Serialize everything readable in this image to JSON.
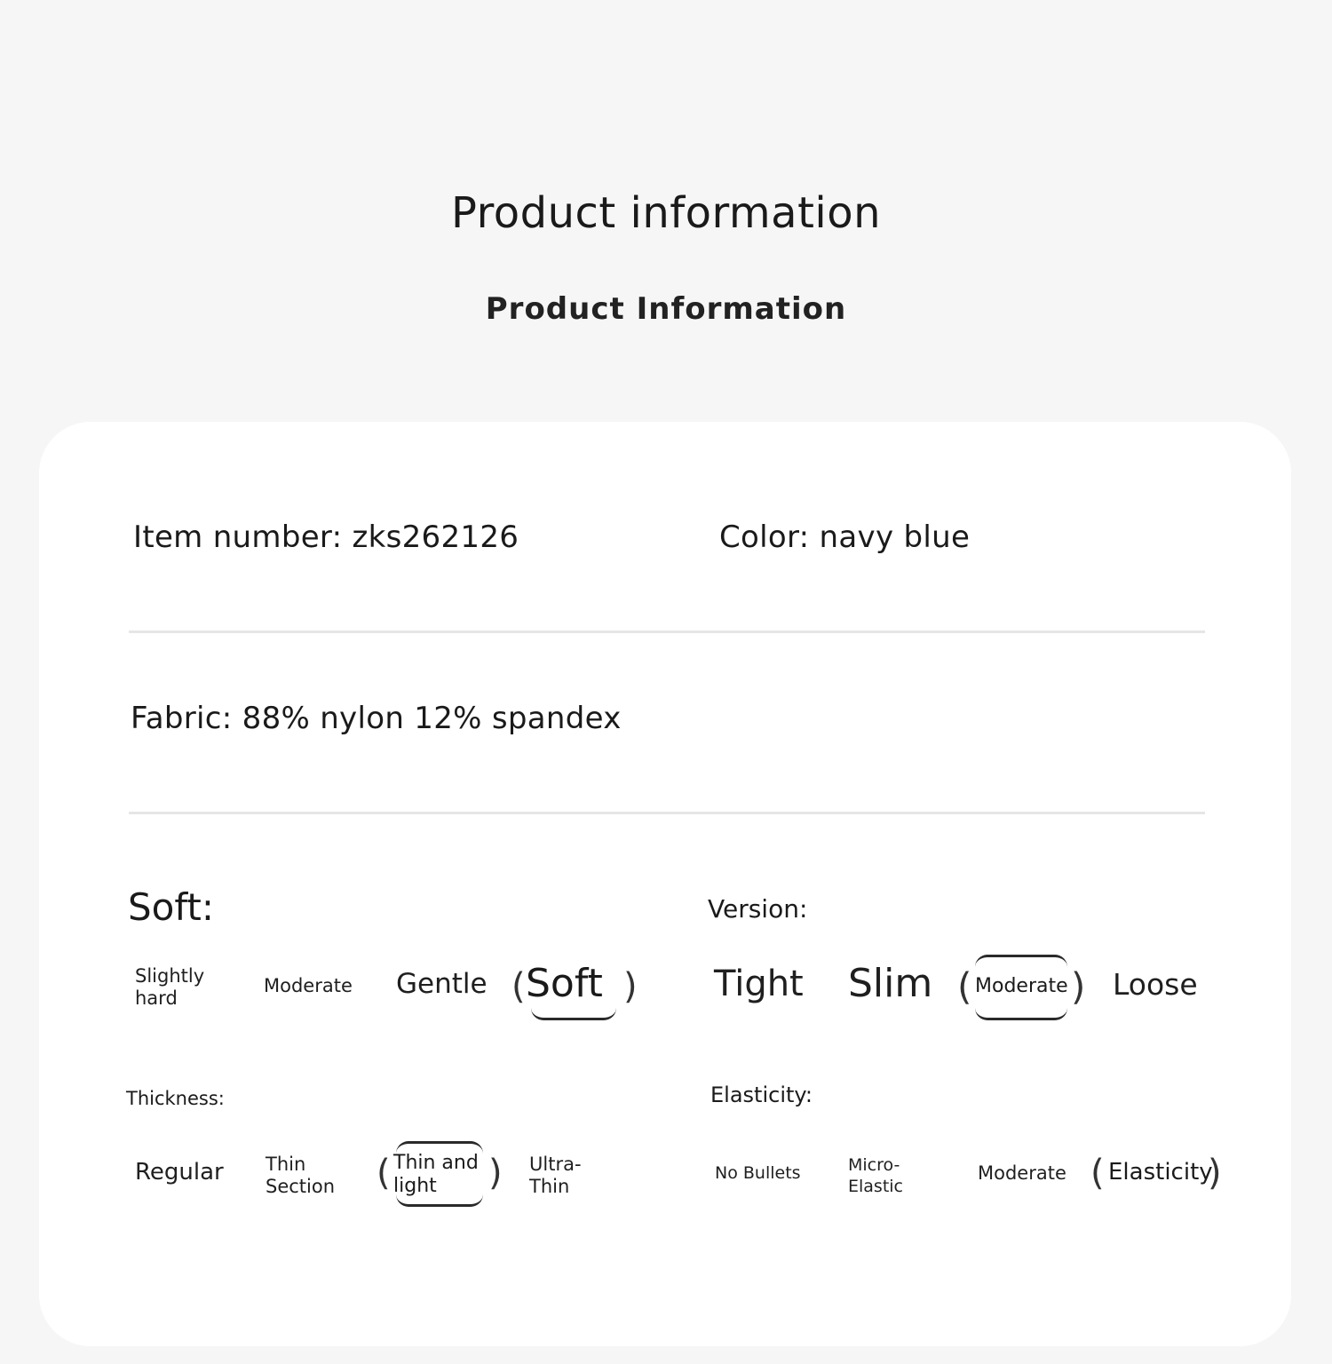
{
  "header": {
    "title": "Product information",
    "subtitle": "Product Information"
  },
  "info": {
    "item_number": "Item number: zks262126",
    "color": "Color: navy blue",
    "fabric": "Fabric: 88% nylon 12% spandex"
  },
  "soft": {
    "label": "Soft:",
    "options": [
      "Slightly hard",
      "Moderate",
      "Gentle",
      "Soft"
    ],
    "selected": "Soft"
  },
  "version": {
    "label": "Version:",
    "options": [
      "Tight",
      "Slim",
      "Moderate",
      "Loose"
    ],
    "selected": "Moderate"
  },
  "thickness": {
    "label": "Thickness:",
    "options": [
      "Regular",
      "Thin Section",
      "Thin and light",
      "Ultra-Thin"
    ],
    "selected": "Thin and light"
  },
  "elasticity": {
    "label": "Elasticity:",
    "options": [
      "No Bullets",
      "Micro-Elastic",
      "Moderate",
      "Elasticity"
    ],
    "selected": "Elasticity"
  }
}
